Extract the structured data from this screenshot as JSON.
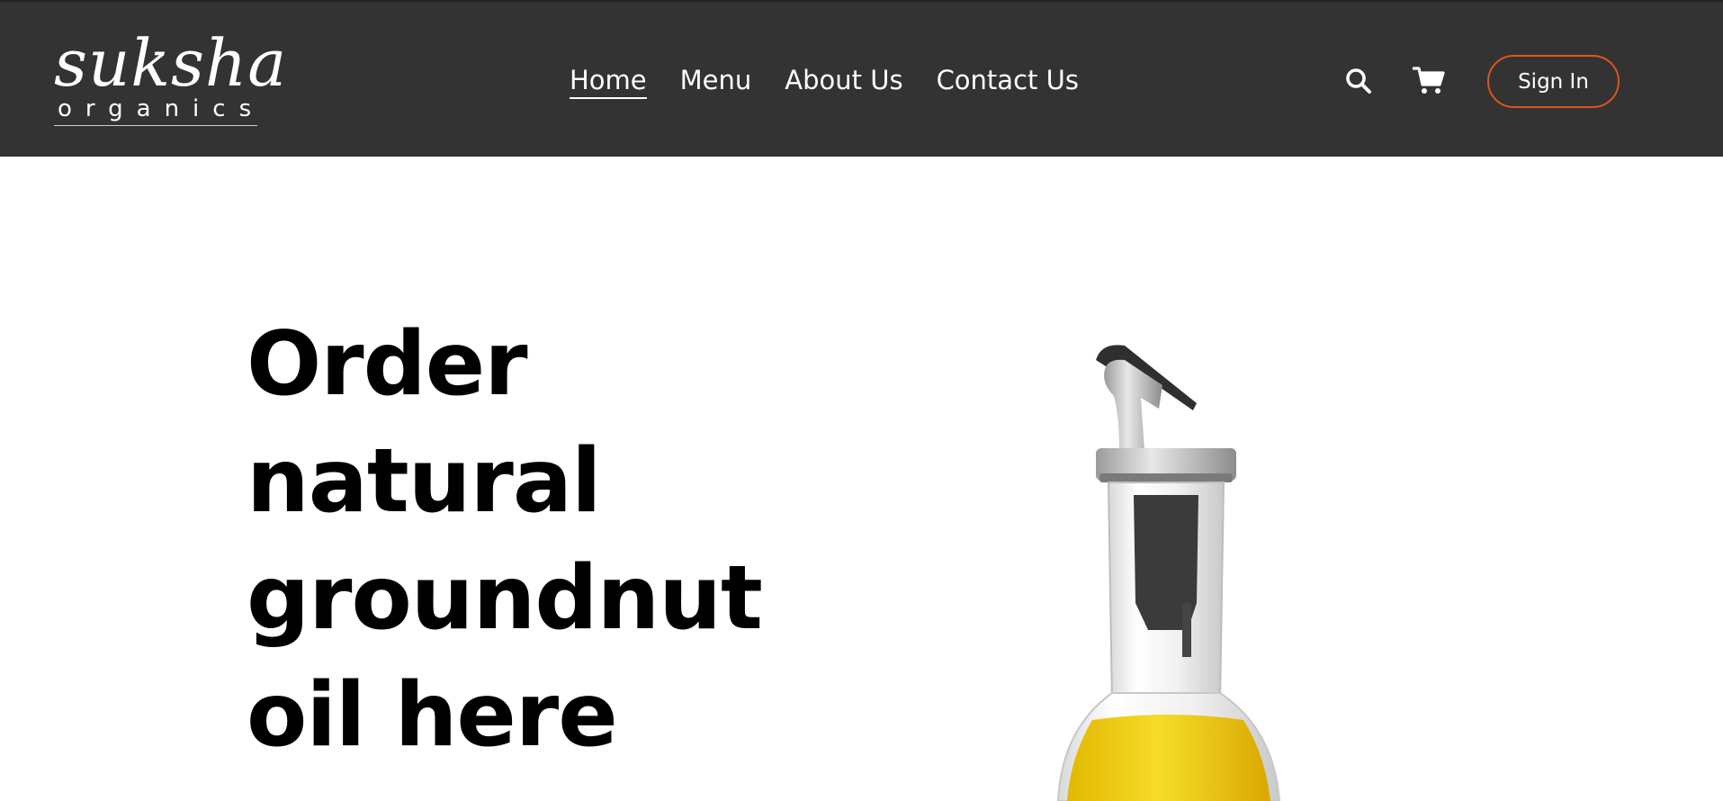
{
  "brand": {
    "name": "suksha",
    "tagline": "organics"
  },
  "nav": {
    "items": [
      {
        "label": "Home",
        "active": true
      },
      {
        "label": "Menu",
        "active": false
      },
      {
        "label": "About Us",
        "active": false
      },
      {
        "label": "Contact Us",
        "active": false
      }
    ]
  },
  "header": {
    "search_icon": "search-icon",
    "cart_icon": "cart-icon",
    "signin_label": "Sign In"
  },
  "hero": {
    "title_lines": [
      "Order",
      "natural",
      "groundnut",
      "oil here"
    ]
  },
  "colors": {
    "header_bg": "#333333",
    "accent": "#e0551a",
    "text_light": "#ffffff",
    "text_dark": "#000000",
    "oil": "#e9c20d"
  }
}
